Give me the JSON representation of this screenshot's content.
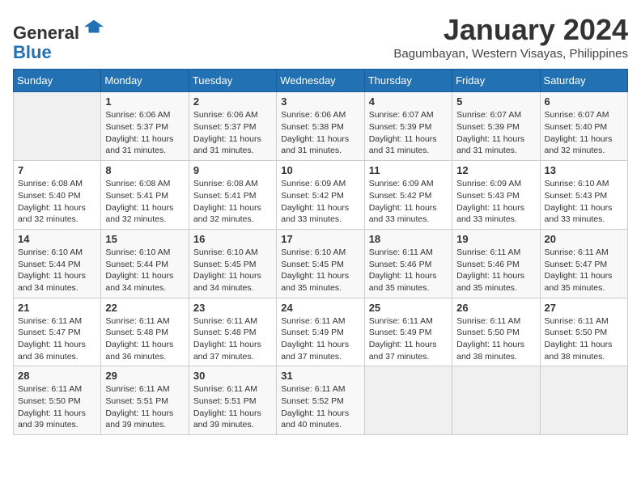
{
  "header": {
    "logo": {
      "line1": "General",
      "line2": "Blue"
    },
    "title": "January 2024",
    "location": "Bagumbayan, Western Visayas, Philippines"
  },
  "weekdays": [
    "Sunday",
    "Monday",
    "Tuesday",
    "Wednesday",
    "Thursday",
    "Friday",
    "Saturday"
  ],
  "weeks": [
    [
      {
        "day": "",
        "sunrise": "",
        "sunset": "",
        "daylight": ""
      },
      {
        "day": "1",
        "sunrise": "6:06 AM",
        "sunset": "5:37 PM",
        "daylight": "11 hours and 31 minutes."
      },
      {
        "day": "2",
        "sunrise": "6:06 AM",
        "sunset": "5:37 PM",
        "daylight": "11 hours and 31 minutes."
      },
      {
        "day": "3",
        "sunrise": "6:06 AM",
        "sunset": "5:38 PM",
        "daylight": "11 hours and 31 minutes."
      },
      {
        "day": "4",
        "sunrise": "6:07 AM",
        "sunset": "5:39 PM",
        "daylight": "11 hours and 31 minutes."
      },
      {
        "day": "5",
        "sunrise": "6:07 AM",
        "sunset": "5:39 PM",
        "daylight": "11 hours and 31 minutes."
      },
      {
        "day": "6",
        "sunrise": "6:07 AM",
        "sunset": "5:40 PM",
        "daylight": "11 hours and 32 minutes."
      }
    ],
    [
      {
        "day": "7",
        "sunrise": "6:08 AM",
        "sunset": "5:40 PM",
        "daylight": "11 hours and 32 minutes."
      },
      {
        "day": "8",
        "sunrise": "6:08 AM",
        "sunset": "5:41 PM",
        "daylight": "11 hours and 32 minutes."
      },
      {
        "day": "9",
        "sunrise": "6:08 AM",
        "sunset": "5:41 PM",
        "daylight": "11 hours and 32 minutes."
      },
      {
        "day": "10",
        "sunrise": "6:09 AM",
        "sunset": "5:42 PM",
        "daylight": "11 hours and 33 minutes."
      },
      {
        "day": "11",
        "sunrise": "6:09 AM",
        "sunset": "5:42 PM",
        "daylight": "11 hours and 33 minutes."
      },
      {
        "day": "12",
        "sunrise": "6:09 AM",
        "sunset": "5:43 PM",
        "daylight": "11 hours and 33 minutes."
      },
      {
        "day": "13",
        "sunrise": "6:10 AM",
        "sunset": "5:43 PM",
        "daylight": "11 hours and 33 minutes."
      }
    ],
    [
      {
        "day": "14",
        "sunrise": "6:10 AM",
        "sunset": "5:44 PM",
        "daylight": "11 hours and 34 minutes."
      },
      {
        "day": "15",
        "sunrise": "6:10 AM",
        "sunset": "5:44 PM",
        "daylight": "11 hours and 34 minutes."
      },
      {
        "day": "16",
        "sunrise": "6:10 AM",
        "sunset": "5:45 PM",
        "daylight": "11 hours and 34 minutes."
      },
      {
        "day": "17",
        "sunrise": "6:10 AM",
        "sunset": "5:45 PM",
        "daylight": "11 hours and 35 minutes."
      },
      {
        "day": "18",
        "sunrise": "6:11 AM",
        "sunset": "5:46 PM",
        "daylight": "11 hours and 35 minutes."
      },
      {
        "day": "19",
        "sunrise": "6:11 AM",
        "sunset": "5:46 PM",
        "daylight": "11 hours and 35 minutes."
      },
      {
        "day": "20",
        "sunrise": "6:11 AM",
        "sunset": "5:47 PM",
        "daylight": "11 hours and 35 minutes."
      }
    ],
    [
      {
        "day": "21",
        "sunrise": "6:11 AM",
        "sunset": "5:47 PM",
        "daylight": "11 hours and 36 minutes."
      },
      {
        "day": "22",
        "sunrise": "6:11 AM",
        "sunset": "5:48 PM",
        "daylight": "11 hours and 36 minutes."
      },
      {
        "day": "23",
        "sunrise": "6:11 AM",
        "sunset": "5:48 PM",
        "daylight": "11 hours and 37 minutes."
      },
      {
        "day": "24",
        "sunrise": "6:11 AM",
        "sunset": "5:49 PM",
        "daylight": "11 hours and 37 minutes."
      },
      {
        "day": "25",
        "sunrise": "6:11 AM",
        "sunset": "5:49 PM",
        "daylight": "11 hours and 37 minutes."
      },
      {
        "day": "26",
        "sunrise": "6:11 AM",
        "sunset": "5:50 PM",
        "daylight": "11 hours and 38 minutes."
      },
      {
        "day": "27",
        "sunrise": "6:11 AM",
        "sunset": "5:50 PM",
        "daylight": "11 hours and 38 minutes."
      }
    ],
    [
      {
        "day": "28",
        "sunrise": "6:11 AM",
        "sunset": "5:50 PM",
        "daylight": "11 hours and 39 minutes."
      },
      {
        "day": "29",
        "sunrise": "6:11 AM",
        "sunset": "5:51 PM",
        "daylight": "11 hours and 39 minutes."
      },
      {
        "day": "30",
        "sunrise": "6:11 AM",
        "sunset": "5:51 PM",
        "daylight": "11 hours and 39 minutes."
      },
      {
        "day": "31",
        "sunrise": "6:11 AM",
        "sunset": "5:52 PM",
        "daylight": "11 hours and 40 minutes."
      },
      {
        "day": "",
        "sunrise": "",
        "sunset": "",
        "daylight": ""
      },
      {
        "day": "",
        "sunrise": "",
        "sunset": "",
        "daylight": ""
      },
      {
        "day": "",
        "sunrise": "",
        "sunset": "",
        "daylight": ""
      }
    ]
  ],
  "labels": {
    "sunrise_prefix": "Sunrise: ",
    "sunset_prefix": "Sunset: ",
    "daylight_prefix": "Daylight: "
  }
}
